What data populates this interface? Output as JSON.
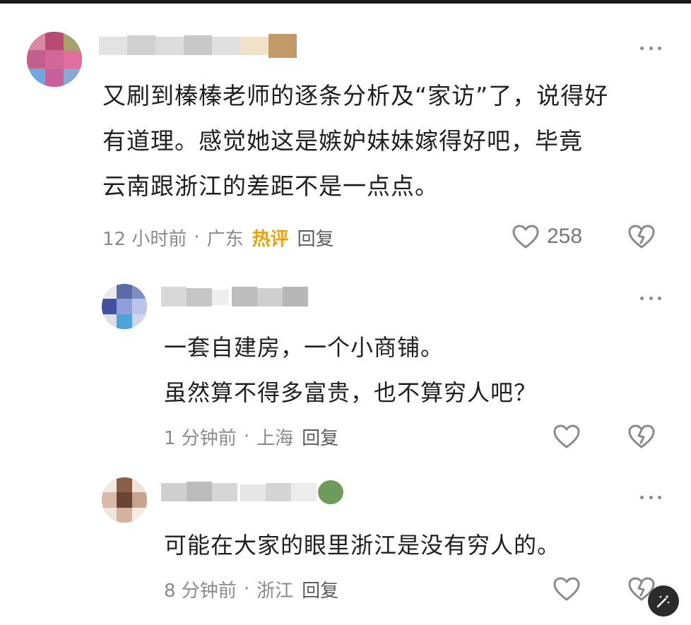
{
  "comments": [
    {
      "text_lines": [
        "又刷到榛榛老师的逐条分析及“家访”了，说得好",
        "有道理。感觉她这是嫉妒妹妹嫁得好吧，毕竟",
        "云南跟浙江的差距不是一点点。"
      ],
      "time": "12 小时前",
      "separator": "·",
      "location": "广东",
      "badge": "热评",
      "reply_label": "回复",
      "likes": "258"
    },
    {
      "text_lines": [
        "一套自建房，一个小商铺。",
        "虽然算不得多富贵，也不算穷人吧？"
      ],
      "time": "1 分钟前",
      "separator": "·",
      "location": "上海",
      "reply_label": "回复"
    },
    {
      "text_lines": [
        "可能在大家的眼里浙江是没有穷人的。"
      ],
      "time": "8 分钟前",
      "separator": "·",
      "location": "浙江",
      "reply_label": "回复"
    }
  ],
  "colors": {
    "hot_badge": "#e8a20a",
    "meta_text": "#8a8a8a",
    "body_text": "#1f1f1f",
    "icon_stroke": "#8a8a8a"
  },
  "icons": [
    "more-icon",
    "heart-icon",
    "dislike-broken-heart-icon",
    "magic-wand-icon"
  ]
}
